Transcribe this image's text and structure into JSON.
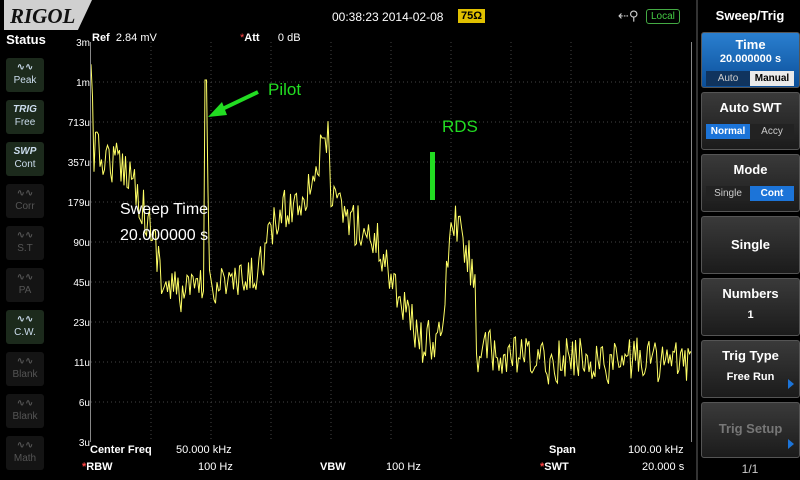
{
  "header": {
    "brand": "RIGOL",
    "datetime": "00:38:23 2014-02-08",
    "impedance": "75Ω",
    "usb_icon": "usb-icon",
    "remote_state": "Local"
  },
  "status": {
    "title": "Status",
    "items": [
      {
        "icon": "peak-icon",
        "label": "Peak",
        "active": true
      },
      {
        "icon": "trig-icon",
        "icon_text": "TRIG",
        "label": "Free",
        "active": true
      },
      {
        "icon": "swp-icon",
        "icon_text": "SWP",
        "label": "Cont",
        "active": true
      },
      {
        "icon": "corr-icon",
        "label": "Corr",
        "active": false
      },
      {
        "icon": "st-icon",
        "label": "S.T",
        "active": false
      },
      {
        "icon": "pa-icon",
        "label": "PA",
        "active": false
      },
      {
        "icon": "cw-icon",
        "label": "C.W.",
        "active": true
      },
      {
        "icon": "blank-icon",
        "label": "Blank",
        "active": false
      },
      {
        "icon": "blank-icon",
        "label": "Blank",
        "active": false
      },
      {
        "icon": "math-icon",
        "label": "Math",
        "active": false
      }
    ]
  },
  "display": {
    "ref_label": "Ref",
    "ref_value": "2.84 mV",
    "att_label": "Att",
    "att_value": "0 dB",
    "y_ticks": [
      "3m",
      "1m",
      "713u",
      "357u",
      "179u",
      "90u",
      "45u",
      "23u",
      "11u",
      "6u",
      "3u"
    ],
    "center_freq_label": "Center Freq",
    "center_freq_value": "50.000 kHz",
    "span_label": "Span",
    "span_value": "100.00 kHz",
    "rbw_label": "RBW",
    "rbw_value": "100 Hz",
    "vbw_label": "VBW",
    "vbw_value": "100 Hz",
    "swt_label": "SWT",
    "swt_value": "20.000 s",
    "trace_color": "#ffff66"
  },
  "annotations": {
    "pilot": "Pilot",
    "rds": "RDS",
    "sweep_line1": "Sweep Time",
    "sweep_line2": "20.000000 s",
    "color": "#22dd22"
  },
  "menu": {
    "title": "Sweep/Trig",
    "time": {
      "label": "Time",
      "value": "20.000000 s",
      "opt_a": "Auto",
      "opt_b": "Manual"
    },
    "auto_swt": {
      "label": "Auto SWT",
      "opt_a": "Normal",
      "opt_b": "Accy"
    },
    "mode": {
      "label": "Mode",
      "opt_a": "Single",
      "opt_b": "Cont"
    },
    "single": {
      "label": "Single"
    },
    "numbers": {
      "label": "Numbers",
      "value": "1"
    },
    "trig_type": {
      "label": "Trig Type",
      "value": "Free Run"
    },
    "trig_setup": {
      "label": "Trig Setup"
    },
    "page": "1/1"
  }
}
